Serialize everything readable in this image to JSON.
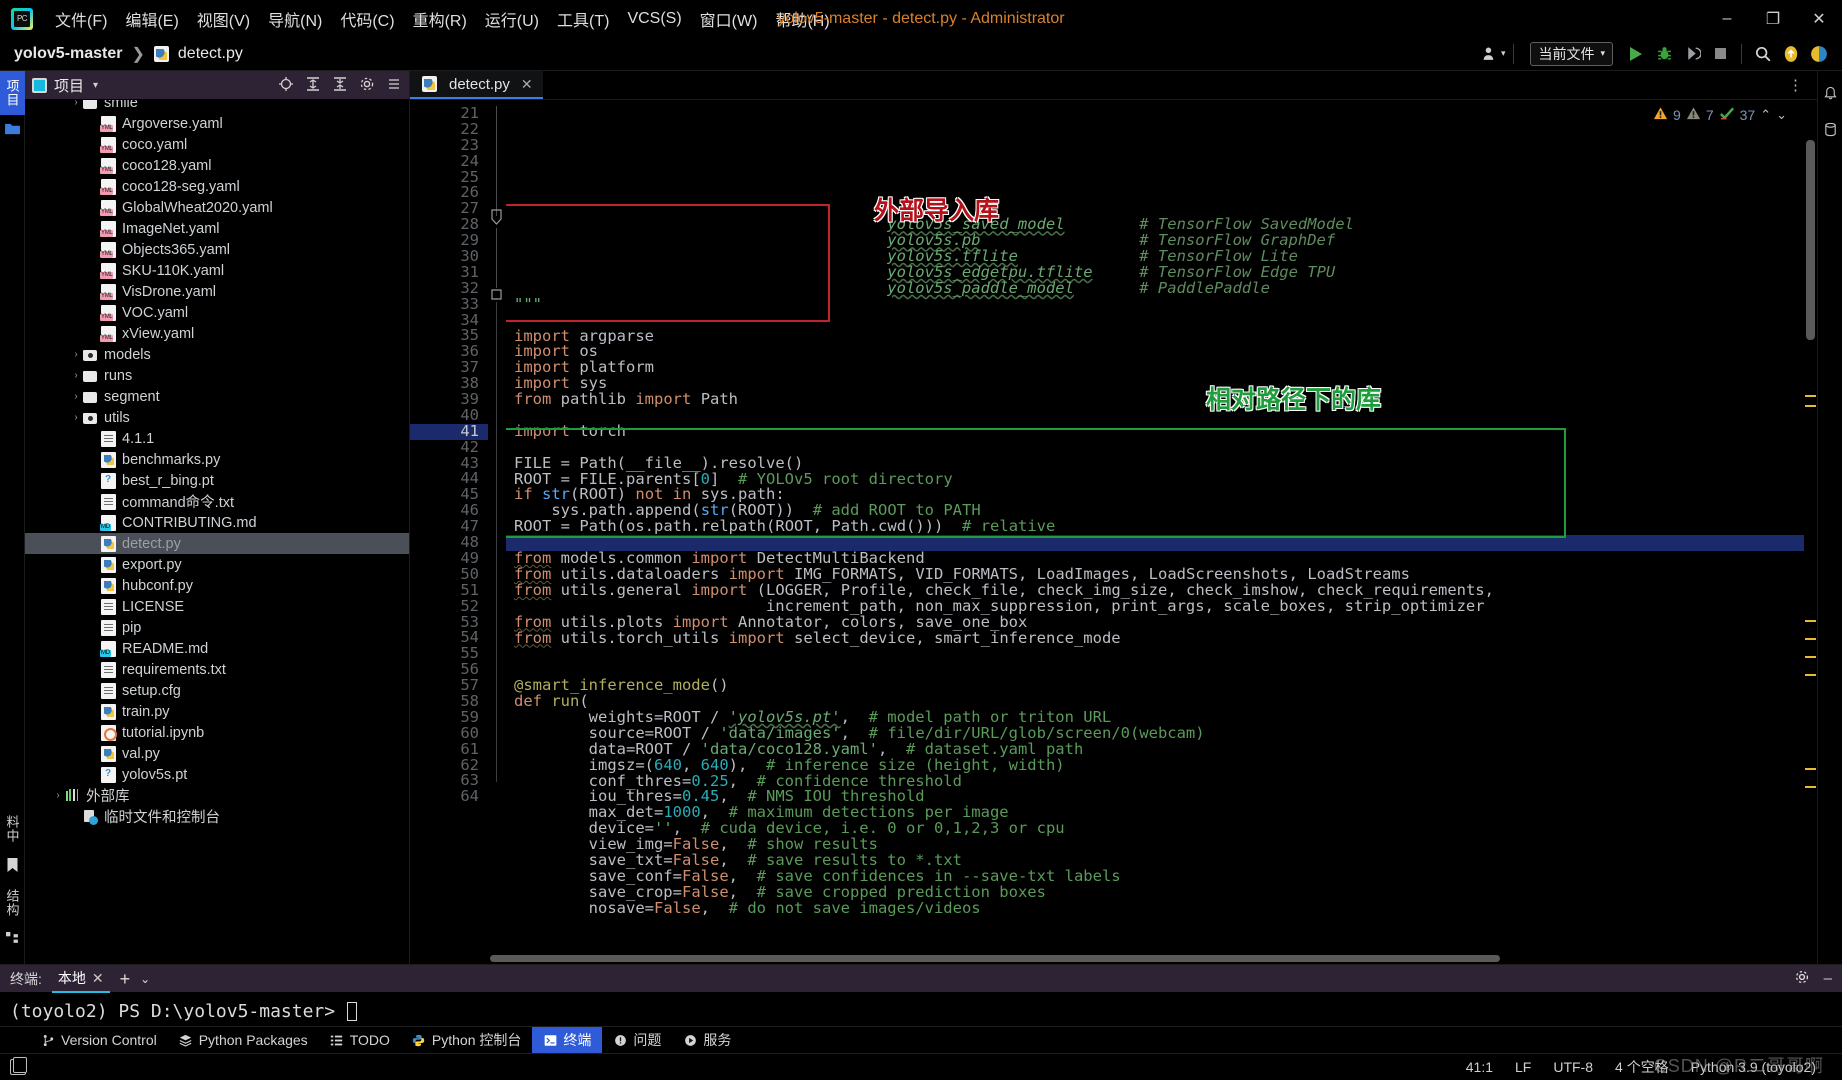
{
  "titlebar": {
    "logo_icon": "pycharm-logo-icon",
    "menu": [
      {
        "label": "文件(F)",
        "name": "menu-file"
      },
      {
        "label": "编辑(E)",
        "name": "menu-edit"
      },
      {
        "label": "视图(V)",
        "name": "menu-view"
      },
      {
        "label": "导航(N)",
        "name": "menu-navigate"
      },
      {
        "label": "代码(C)",
        "name": "menu-code"
      },
      {
        "label": "重构(R)",
        "name": "menu-refactor"
      },
      {
        "label": "运行(U)",
        "name": "menu-run"
      },
      {
        "label": "工具(T)",
        "name": "menu-tools"
      },
      {
        "label": "VCS(S)",
        "name": "menu-vcs"
      },
      {
        "label": "窗口(W)",
        "name": "menu-window"
      },
      {
        "label": "帮助(H)",
        "name": "menu-help"
      }
    ],
    "window_title": "yolov5-master - detect.py - Administrator",
    "minimize": "–",
    "maximize": "❐",
    "close": "✕"
  },
  "navbar": {
    "breadcrumb_project": "yolov5-master",
    "breadcrumb_sep": "❯",
    "breadcrumb_file": "detect.py",
    "run_config": "当前文件",
    "run_config_caret": "▾",
    "buttons": {
      "profile": "user-avatar-icon",
      "run": "run-icon",
      "debug": "debug-icon",
      "coverage": "run-with-coverage-icon",
      "stop": "stop-icon",
      "search": "search-everywhere-icon",
      "updates": "updates-icon",
      "settings": "settings-icon"
    }
  },
  "left_rail": {
    "project_tab": "项目",
    "bookmark_icon": "bookmark-icon",
    "structure_tab": "结构",
    "folder_icon": "folder-icon",
    "bottom_tab": "料中"
  },
  "project_panel": {
    "title": "项目",
    "caret": "▾",
    "actions": [
      "locate-icon",
      "expand-all-icon",
      "collapse-all-icon",
      "settings-icon",
      "hide-icon"
    ],
    "tree": [
      {
        "label": "smile",
        "type": "folder",
        "indent": 2,
        "arrow": "›",
        "clipped": true
      },
      {
        "label": "Argoverse.yaml",
        "type": "yml",
        "indent": 3,
        "arrow": ""
      },
      {
        "label": "coco.yaml",
        "type": "yml",
        "indent": 3,
        "arrow": ""
      },
      {
        "label": "coco128.yaml",
        "type": "yml",
        "indent": 3,
        "arrow": ""
      },
      {
        "label": "coco128-seg.yaml",
        "type": "yml",
        "indent": 3,
        "arrow": ""
      },
      {
        "label": "GlobalWheat2020.yaml",
        "type": "yml",
        "indent": 3,
        "arrow": ""
      },
      {
        "label": "ImageNet.yaml",
        "type": "yml",
        "indent": 3,
        "arrow": ""
      },
      {
        "label": "Objects365.yaml",
        "type": "yml",
        "indent": 3,
        "arrow": ""
      },
      {
        "label": "SKU-110K.yaml",
        "type": "yml",
        "indent": 3,
        "arrow": ""
      },
      {
        "label": "VisDrone.yaml",
        "type": "yml",
        "indent": 3,
        "arrow": ""
      },
      {
        "label": "VOC.yaml",
        "type": "yml",
        "indent": 3,
        "arrow": ""
      },
      {
        "label": "xView.yaml",
        "type": "yml",
        "indent": 3,
        "arrow": ""
      },
      {
        "label": "models",
        "type": "folder-src",
        "indent": 2,
        "arrow": "›"
      },
      {
        "label": "runs",
        "type": "folder",
        "indent": 2,
        "arrow": "›"
      },
      {
        "label": "segment",
        "type": "folder",
        "indent": 2,
        "arrow": "›"
      },
      {
        "label": "utils",
        "type": "folder-src",
        "indent": 2,
        "arrow": "›"
      },
      {
        "label": "4.1.1",
        "type": "txt",
        "indent": 3,
        "arrow": ""
      },
      {
        "label": "benchmarks.py",
        "type": "py",
        "indent": 3,
        "arrow": ""
      },
      {
        "label": "best_r_bing.pt",
        "type": "pt",
        "indent": 3,
        "arrow": ""
      },
      {
        "label": "command命令.txt",
        "type": "txt",
        "indent": 3,
        "arrow": ""
      },
      {
        "label": "CONTRIBUTING.md",
        "type": "md",
        "indent": 3,
        "arrow": ""
      },
      {
        "label": "detect.py",
        "type": "py",
        "indent": 3,
        "arrow": "",
        "selected": true
      },
      {
        "label": "export.py",
        "type": "py",
        "indent": 3,
        "arrow": ""
      },
      {
        "label": "hubconf.py",
        "type": "py",
        "indent": 3,
        "arrow": ""
      },
      {
        "label": "LICENSE",
        "type": "txt",
        "indent": 3,
        "arrow": ""
      },
      {
        "label": "pip",
        "type": "txt",
        "indent": 3,
        "arrow": ""
      },
      {
        "label": "README.md",
        "type": "md",
        "indent": 3,
        "arrow": ""
      },
      {
        "label": "requirements.txt",
        "type": "txt",
        "indent": 3,
        "arrow": ""
      },
      {
        "label": "setup.cfg",
        "type": "txt",
        "indent": 3,
        "arrow": ""
      },
      {
        "label": "train.py",
        "type": "py",
        "indent": 3,
        "arrow": ""
      },
      {
        "label": "tutorial.ipynb",
        "type": "nb",
        "indent": 3,
        "arrow": ""
      },
      {
        "label": "val.py",
        "type": "py",
        "indent": 3,
        "arrow": ""
      },
      {
        "label": "yolov5s.pt",
        "type": "pt",
        "indent": 3,
        "arrow": ""
      },
      {
        "label": "外部库",
        "type": "lib",
        "indent": 1,
        "arrow": "›"
      },
      {
        "label": "临时文件和控制台",
        "type": "scratch",
        "indent": 2,
        "arrow": ""
      }
    ]
  },
  "editor": {
    "tab_label": "detect.py",
    "tab_close": "✕",
    "more_icon": "⋮",
    "inspection": {
      "warning_count": "9",
      "weak_count": "7",
      "ok_count": "37",
      "up": "⌃",
      "down": "⌄"
    },
    "first_line": 21,
    "lines": [
      {
        "n": 21,
        "html": "                                        <span class='stu'>yolov5s_saved_model</span>        <span class='cmi'># TensorFlow SavedModel</span>"
      },
      {
        "n": 22,
        "html": "                                        <span class='stu'>yolov5s.pb</span>                 <span class='cmi'># TensorFlow GraphDef</span>"
      },
      {
        "n": 23,
        "html": "                                        <span class='stu'>yolov5s.tflite</span>             <span class='cmi'># TensorFlow Lite</span>"
      },
      {
        "n": 24,
        "html": "                                        <span class='stu'>yolov5s_edgetpu.tflite</span>     <span class='cmi'># TensorFlow Edge TPU</span>"
      },
      {
        "n": 25,
        "html": "                                        <span class='stu'>yolov5s_paddle_model</span>       <span class='cmi'># PaddlePaddle</span>"
      },
      {
        "n": 26,
        "html": "<span class='st'>\"\"\"</span>"
      },
      {
        "n": 27,
        "html": ""
      },
      {
        "n": 28,
        "html": "<span class='kw'>import</span> <span class='id'>argparse</span>"
      },
      {
        "n": 29,
        "html": "<span class='kw'>import</span> <span class='id'>os</span>"
      },
      {
        "n": 30,
        "html": "<span class='kw'>import</span> <span class='id'>platform</span>"
      },
      {
        "n": 31,
        "html": "<span class='kw'>import</span> <span class='id'>sys</span>"
      },
      {
        "n": 32,
        "html": "<span class='kw'>from</span> <span class='id'>pathlib</span> <span class='kw'>import</span> <span class='id'>Path</span>"
      },
      {
        "n": 33,
        "html": ""
      },
      {
        "n": 34,
        "html": "<span class='kw'>import</span> <span class='id'>torch</span>"
      },
      {
        "n": 35,
        "html": ""
      },
      {
        "n": 36,
        "html": "<span class='id'>FILE</span> = <span class='id'>Path</span>(<span class='id'>__file__</span>).<span class='id'>resolve</span>()"
      },
      {
        "n": 37,
        "html": "<span class='id'>ROOT</span> = <span class='id'>FILE</span>.<span class='id'>parents</span>[<span class='num'>0</span>]  <span class='cmt'># YOLOv5 root directory</span>"
      },
      {
        "n": 38,
        "html": "<span class='kw'>if</span> <span class='fn'>str</span>(<span class='id'>ROOT</span>) <span class='kw'>not in</span> <span class='id'>sys</span>.<span class='id'>path</span>:"
      },
      {
        "n": 39,
        "html": "    <span class='id'>sys</span>.<span class='id'>path</span>.<span class='id'>append</span>(<span class='fn'>str</span>(<span class='id'>ROOT</span>))  <span class='cmt'># add ROOT to PATH</span>"
      },
      {
        "n": 40,
        "html": "<span class='id'>ROOT</span> = <span class='id'>Path</span>(<span class='id'>os</span>.<span class='id'>path</span>.<span class='id'>relpath</span>(<span class='id'>ROOT</span>, <span class='id'>Path</span>.<span class='id'>cwd</span>()))  <span class='cmt'># relative</span>"
      },
      {
        "n": 41,
        "html": "",
        "caret": true
      },
      {
        "n": 42,
        "html": "<span class='kw wv'>from</span> <span class='id'>models.common</span> <span class='kw'>import</span> <span class='id'>DetectMultiBackend</span>"
      },
      {
        "n": 43,
        "html": "<span class='kw wv'>from</span> <span class='id'>utils.dataloaders</span> <span class='kw'>import</span> <span class='id'>IMG_FORMATS</span>, <span class='id'>VID_FORMATS</span>, <span class='id'>LoadImages</span>, <span class='id'>LoadScreenshots</span>, <span class='id'>LoadStreams</span>"
      },
      {
        "n": 44,
        "html": "<span class='kw wv'>from</span> <span class='id'>utils.general</span> <span class='kw'>import</span> (<span class='id'>LOGGER</span>, <span class='id'>Profile</span>, <span class='id'>check_file</span>, <span class='id'>check_img_size</span>, <span class='id'>check_imshow</span>, <span class='id'>check_requirements</span>,"
      },
      {
        "n": 45,
        "html": "                           <span class='id'>increment_path</span>, <span class='id'>non_max_suppression</span>, <span class='id'>print_args</span>, <span class='id'>scale_boxes</span>, <span class='id'>strip_optimizer</span>"
      },
      {
        "n": 46,
        "html": "<span class='kw wv'>from</span> <span class='id'>utils.plots</span> <span class='kw'>import</span> <span class='id'>Annotator</span>, <span class='id'>colors</span>, <span class='id'>save_one_box</span>"
      },
      {
        "n": 47,
        "html": "<span class='kw wv'>from</span> <span class='id'>utils.torch_utils</span> <span class='kw'>import</span> <span class='id'>select_device</span>, <span class='id'>smart_inference_mode</span>"
      },
      {
        "n": 48,
        "html": ""
      },
      {
        "n": 49,
        "html": ""
      },
      {
        "n": 50,
        "html": "<span class='dec'>@smart_inference_mode</span>()"
      },
      {
        "n": 51,
        "html": "<span class='kw'>def</span> <span class='dec'>run</span>("
      },
      {
        "n": 52,
        "html": "        <span class='id'>weights</span>=<span class='id'>ROOT</span> / <span class='stu'>'yolov5s.pt'</span>,  <span class='cmt'># model path or triton URL</span>"
      },
      {
        "n": 53,
        "html": "        <span class='id'>source</span>=<span class='id'>ROOT</span> / <span class='st'>'data/images'</span>,  <span class='cmt'># file/dir/URL/glob/screen/0(webcam)</span>"
      },
      {
        "n": 54,
        "html": "        <span class='id'>data</span>=<span class='id'>ROOT</span> / <span class='st'>'data/coco128.yaml'</span>,  <span class='cmt'># dataset.yaml path</span>"
      },
      {
        "n": 55,
        "html": "        <span class='id'>imgsz</span>=(<span class='num'>640</span>, <span class='num'>640</span>),  <span class='cmt'># inference size (height, width)</span>"
      },
      {
        "n": 56,
        "html": "        <span class='id'>conf_thres</span>=<span class='num'>0.25</span>,  <span class='cmt'># confidence threshold</span>"
      },
      {
        "n": 57,
        "html": "        <span class='id'>iou_thres</span>=<span class='num'>0.45</span>,  <span class='cmt'># NMS IOU threshold</span>"
      },
      {
        "n": 58,
        "html": "        <span class='id'>max_det</span>=<span class='num'>1000</span>,  <span class='cmt'># maximum detections per image</span>"
      },
      {
        "n": 59,
        "html": "        <span class='id'>device</span>=<span class='st'>''</span>,  <span class='cmt'># cuda device, i.e. 0 or 0,1,2,3 or cpu</span>"
      },
      {
        "n": 60,
        "html": "        <span class='id'>view_img</span>=<span class='kw'>False</span>,  <span class='cmt'># show results</span>"
      },
      {
        "n": 61,
        "html": "        <span class='id'>save_txt</span>=<span class='kw'>False</span>,  <span class='cmt'># save results to *.txt</span>"
      },
      {
        "n": 62,
        "html": "        <span class='id'>save_conf</span>=<span class='kw'>False</span>,  <span class='cmt'># save confidences in --save-txt labels</span>"
      },
      {
        "n": 63,
        "html": "        <span class='id'>save_crop</span>=<span class='kw'>False</span>,  <span class='cmt'># save cropped prediction boxes</span>"
      },
      {
        "n": 64,
        "html": "        <span class='id'>nosave</span>=<span class='kw'>False</span>,  <span class='cmt'># do not save images/videos</span>"
      }
    ],
    "annotations": [
      {
        "text": "外部导入库",
        "color": "red",
        "name": "annotation-external-imports"
      },
      {
        "text": "相对路径下的库",
        "color": "green",
        "name": "annotation-relative-path-imports"
      }
    ]
  },
  "terminal": {
    "label": "终端:",
    "tab": "本地",
    "tab_close": "✕",
    "add": "+",
    "chevron": "⌄",
    "settings_icon": "gear-icon",
    "minimize_icon": "–",
    "prompt": "(toyolo2) PS D:\\yolov5-master>"
  },
  "tool_window_bar": [
    {
      "label": "Version Control",
      "icon": "branch-icon",
      "active": false
    },
    {
      "label": "Python Packages",
      "icon": "packages-icon",
      "active": false
    },
    {
      "label": "TODO",
      "icon": "todo-icon",
      "active": false
    },
    {
      "label": "Python 控制台",
      "icon": "python-icon",
      "active": false
    },
    {
      "label": "终端",
      "icon": "terminal-icon",
      "active": true
    },
    {
      "label": "问题",
      "icon": "problems-icon",
      "active": false
    },
    {
      "label": "服务",
      "icon": "services-icon",
      "active": false
    }
  ],
  "statusbar": {
    "left_icon": "layout-icon",
    "caret_position": "41:1",
    "line_separator": "LF",
    "encoding": "UTF-8",
    "indent": "4 个空格",
    "interpreter": "Python 3.9 (toyolo2)",
    "watermark": "CSDN @R二哥哥啊"
  }
}
